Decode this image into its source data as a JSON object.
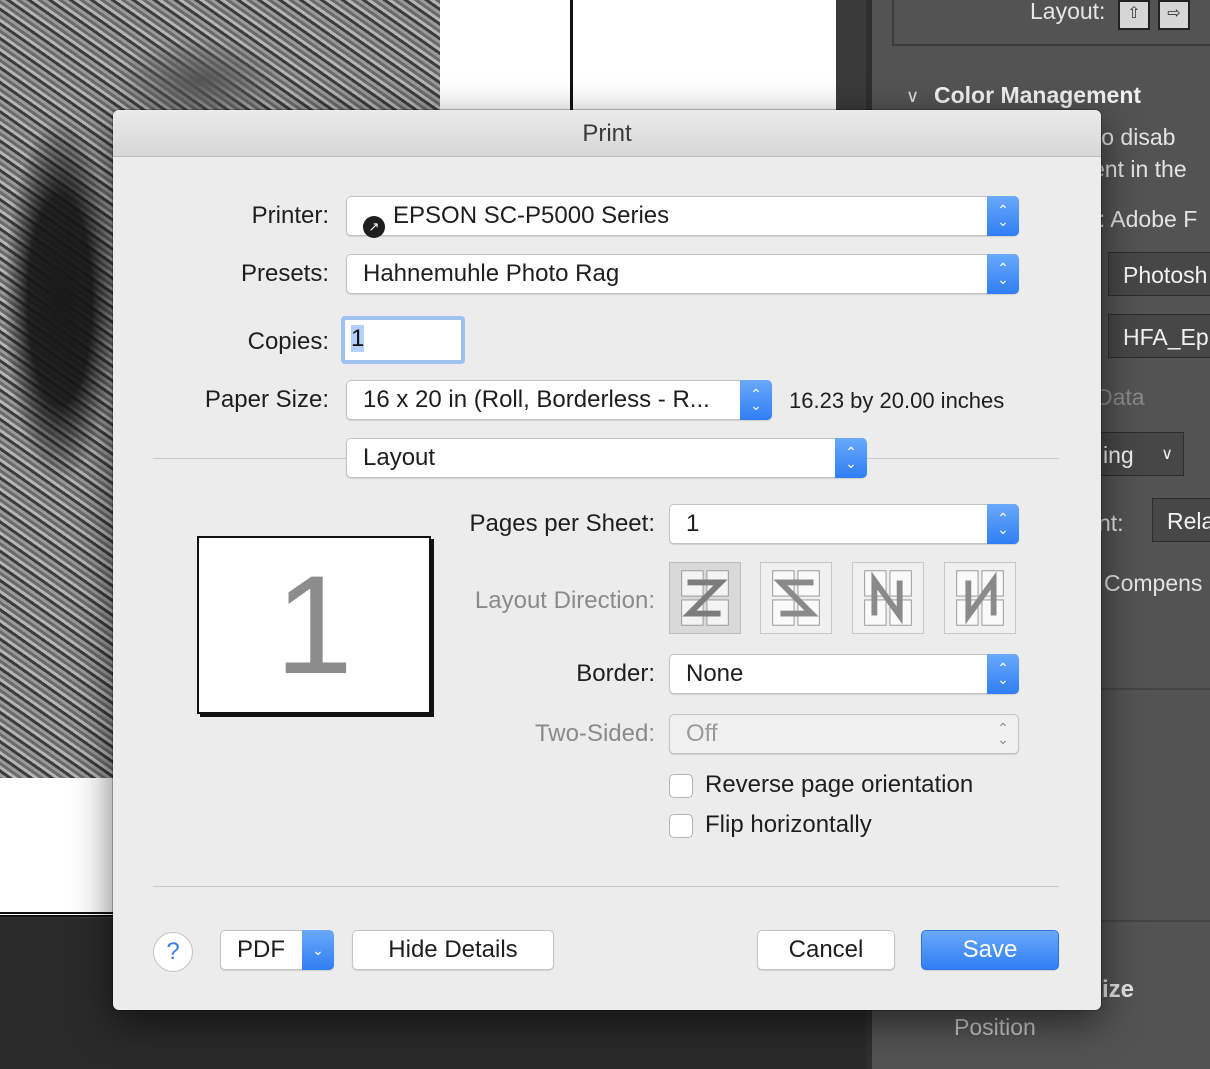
{
  "background": {
    "panel": {
      "layout_label": "Layout:",
      "color_management_heading": "Color Management",
      "fragments": [
        "er to disab",
        "ent in the",
        "e: Adobe F",
        "Photosh",
        "HFA_Ep",
        "Data",
        "ing",
        "nt:",
        "Rela",
        "Compens",
        "ize",
        "Position"
      ]
    }
  },
  "dialog": {
    "title": "Print",
    "printer": {
      "label": "Printer:",
      "value": "EPSON SC-P5000 Series"
    },
    "presets": {
      "label": "Presets:",
      "value": "Hahnemuhle Photo Rag"
    },
    "copies": {
      "label": "Copies:",
      "value": "1"
    },
    "paper_size": {
      "label": "Paper Size:",
      "value": "16 x 20 in (Roll, Borderless - R...",
      "description": "16.23 by 20.00 inches"
    },
    "section_popup": {
      "value": "Layout"
    },
    "preview_page_number": "1",
    "pages_per_sheet": {
      "label": "Pages per Sheet:",
      "value": "1"
    },
    "layout_direction": {
      "label": "Layout Direction:",
      "options": [
        "Z",
        "S",
        "N-reverse",
        "N"
      ],
      "selected_index": 0
    },
    "border": {
      "label": "Border:",
      "value": "None"
    },
    "two_sided": {
      "label": "Two-Sided:",
      "value": "Off"
    },
    "reverse_orientation": {
      "label": "Reverse page orientation",
      "checked": false
    },
    "flip_horizontally": {
      "label": "Flip horizontally",
      "checked": false
    },
    "footer": {
      "help_label": "?",
      "pdf_label": "PDF",
      "hide_details_label": "Hide Details",
      "cancel_label": "Cancel",
      "save_label": "Save"
    }
  },
  "colors": {
    "accent": "#2f7ef3",
    "dialog_bg": "#ececec",
    "panel_bg": "#535353"
  }
}
